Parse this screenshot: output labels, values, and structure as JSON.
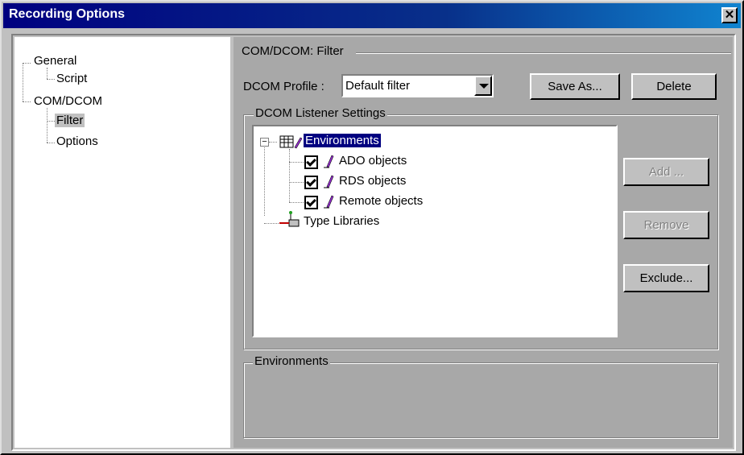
{
  "window": {
    "title": "Recording Options"
  },
  "nav": {
    "items": [
      {
        "label": "General"
      },
      {
        "label": "Script"
      },
      {
        "label": "COM/DCOM"
      },
      {
        "label": "Filter"
      },
      {
        "label": "Options"
      }
    ]
  },
  "panel": {
    "group_title": "COM/DCOM: Filter",
    "profile_label": "DCOM Profile :",
    "profile_value": "Default filter",
    "save_as_label": "Save As...",
    "delete_label": "Delete",
    "listener_title": "DCOM Listener Settings",
    "tree": {
      "root": "Environments",
      "children": [
        "ADO objects",
        "RDS objects",
        "Remote objects"
      ],
      "type_libraries": "Type Libraries"
    },
    "add_label": "Add ...",
    "remove_label": "Remove",
    "exclude_label": "Exclude...",
    "details_title": "Environments"
  },
  "colors": {
    "title_bar": "#000080",
    "selection": "#000080",
    "dialog": "#c0c0c0"
  }
}
